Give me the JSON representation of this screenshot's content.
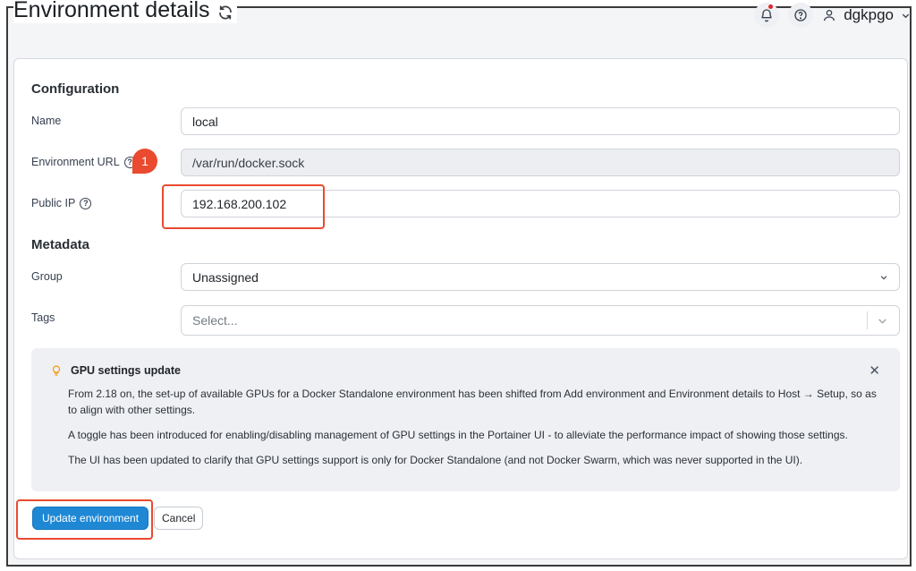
{
  "header": {
    "title": "Environment details",
    "username": "dgkpgo"
  },
  "config": {
    "section_title": "Configuration",
    "name_label": "Name",
    "name_value": "local",
    "url_label": "Environment URL",
    "url_value": "/var/run/docker.sock",
    "ip_label": "Public IP",
    "ip_value": "192.168.200.102"
  },
  "metadata": {
    "section_title": "Metadata",
    "group_label": "Group",
    "group_value": "Unassigned",
    "tags_label": "Tags",
    "tags_placeholder": "Select..."
  },
  "callout": {
    "title": "GPU settings update",
    "p1": "From 2.18 on, the set-up of available GPUs for a Docker Standalone environment has been shifted from Add environment and Environment details to Host → Setup, so as to align with other settings.",
    "p2": "A toggle has been introduced for enabling/disabling management of GPU settings in the Portainer UI - to alleviate the performance impact of showing those settings.",
    "p3": "The UI has been updated to clarify that GPU settings support is only for Docker Standalone (and not Docker Swarm, which was never supported in the UI)."
  },
  "actions": {
    "update_label": "Update environment",
    "cancel_label": "Cancel"
  },
  "annotation": {
    "pin_number": "1",
    "color": "#ea4a2f"
  },
  "colors": {
    "primary": "#1e88d5",
    "notification": "#e0262f"
  }
}
